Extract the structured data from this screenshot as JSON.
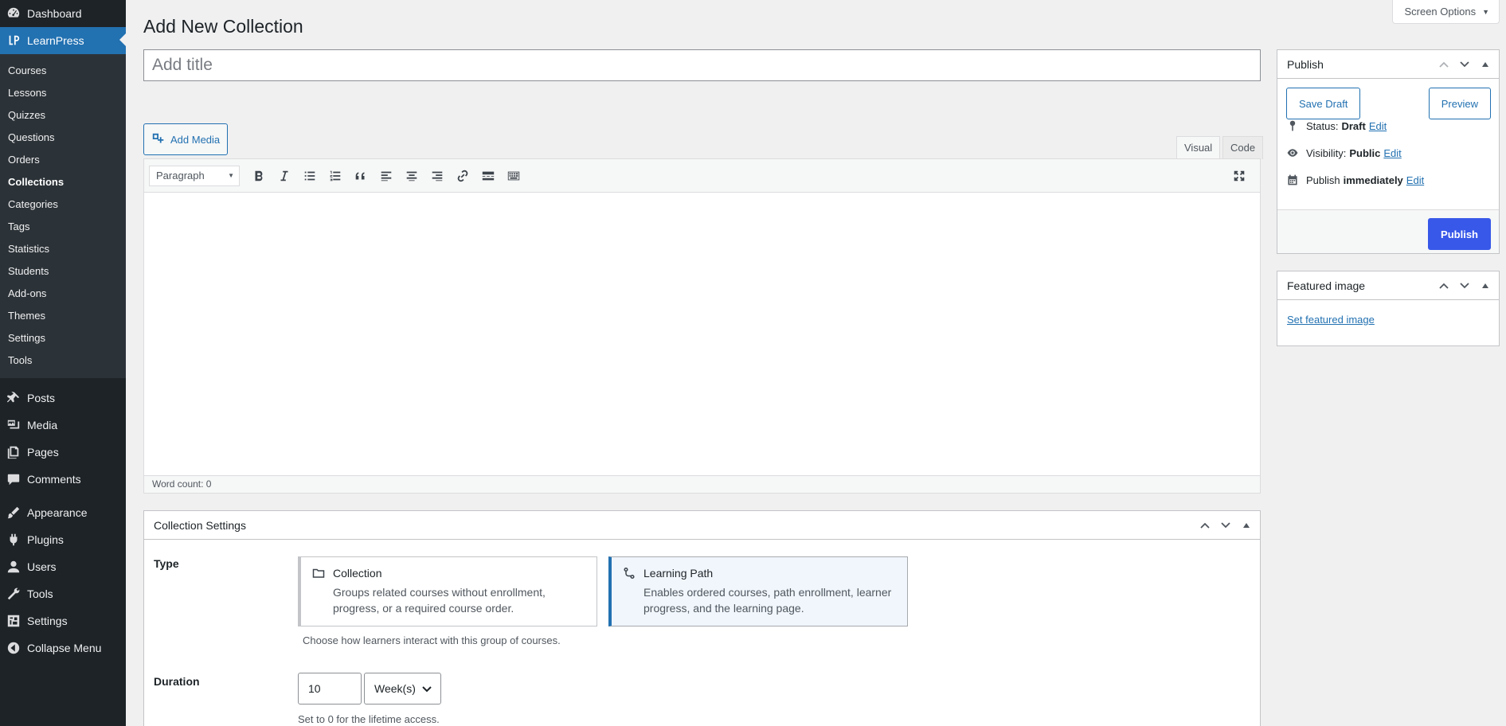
{
  "sidebar": {
    "dashboard": "Dashboard",
    "learnpress": "LearnPress",
    "submenu": [
      "Courses",
      "Lessons",
      "Quizzes",
      "Questions",
      "Orders",
      "Collections",
      "Categories",
      "Tags",
      "Statistics",
      "Students",
      "Add-ons",
      "Themes",
      "Settings",
      "Tools"
    ],
    "current_submenu": "Collections",
    "menu": [
      {
        "label": "Posts",
        "icon": "pin-icon"
      },
      {
        "label": "Media",
        "icon": "media-icon"
      },
      {
        "label": "Pages",
        "icon": "pages-icon"
      },
      {
        "label": "Comments",
        "icon": "comments-icon"
      },
      {
        "label": "Appearance",
        "icon": "brush-icon"
      },
      {
        "label": "Plugins",
        "icon": "plugins-icon"
      },
      {
        "label": "Users",
        "icon": "users-icon"
      },
      {
        "label": "Tools",
        "icon": "wrench-icon"
      },
      {
        "label": "Settings",
        "icon": "settings-icon"
      },
      {
        "label": "Collapse Menu",
        "icon": "collapse-icon"
      }
    ]
  },
  "header": {
    "screen_options": "Screen Options",
    "page_title": "Add New Collection"
  },
  "title_field": {
    "placeholder": "Add title",
    "value": ""
  },
  "editor": {
    "add_media": "Add Media",
    "tab_visual": "Visual",
    "tab_code": "Code",
    "format": "Paragraph",
    "word_count": "Word count: 0"
  },
  "publish": {
    "title": "Publish",
    "save_draft": "Save Draft",
    "preview": "Preview",
    "status_label": "Status:",
    "status_value": "Draft",
    "visibility_label": "Visibility:",
    "visibility_value": "Public",
    "schedule_label": "Publish",
    "schedule_value": "immediately",
    "edit": "Edit",
    "publish_button": "Publish"
  },
  "featured_image": {
    "title": "Featured image",
    "link": "Set featured image"
  },
  "collection_settings": {
    "title": "Collection Settings",
    "type_label": "Type",
    "types": [
      {
        "title": "Collection",
        "desc": "Groups related courses without enrollment, progress, or a required course order.",
        "selected": false
      },
      {
        "title": "Learning Path",
        "desc": "Enables ordered courses, path enrollment, learner progress, and the learning page.",
        "selected": true
      }
    ],
    "type_help": "Choose how learners interact with this group of courses.",
    "duration_label": "Duration",
    "duration_value": "10",
    "duration_unit": "Week(s)",
    "duration_help": "Set to 0 for the lifetime access."
  },
  "colors": {
    "admin_sidebar": "#1d2327",
    "submenu_bg": "#2c3338",
    "accent": "#2271b1",
    "publish_button": "#3858e9"
  }
}
